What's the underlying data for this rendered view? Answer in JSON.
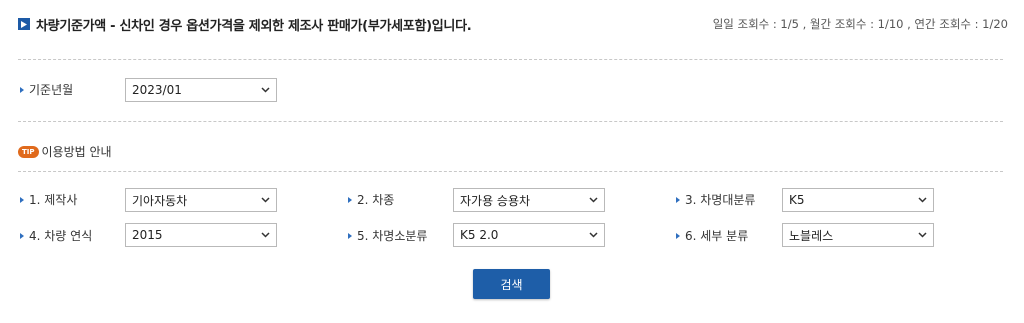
{
  "header": {
    "title": "차량기준가액 - 신차인 경우 옵션가격을 제외한 제조사 판매가(부가세포함)입니다.",
    "counts": "일일 조회수 : 1/5 , 월간 조회수 : 1/10 , 연간 조회수 : 1/20"
  },
  "base_date": {
    "label": "기준년월",
    "value": "2023/01"
  },
  "tip": {
    "badge": "TIP",
    "label": "이용방법 안내"
  },
  "fields": [
    {
      "label": "1. 제작사",
      "value": "기아자동차"
    },
    {
      "label": "2. 차종",
      "value": "자가용 승용차"
    },
    {
      "label": "3. 차명대분류",
      "value": "K5"
    },
    {
      "label": "4. 차량 연식",
      "value": "2015"
    },
    {
      "label": "5. 차명소분류",
      "value": "K5 2.0"
    },
    {
      "label": "6. 세부 분류",
      "value": "노블레스"
    }
  ],
  "search_button": {
    "label": "검색"
  },
  "colors": {
    "accent": "#1e5ea8",
    "tip": "#e06a1c"
  },
  "icons": {
    "title": "square-play-icon",
    "bullet": "triangle-bullet-icon",
    "dropdown": "chevron-down-icon"
  }
}
